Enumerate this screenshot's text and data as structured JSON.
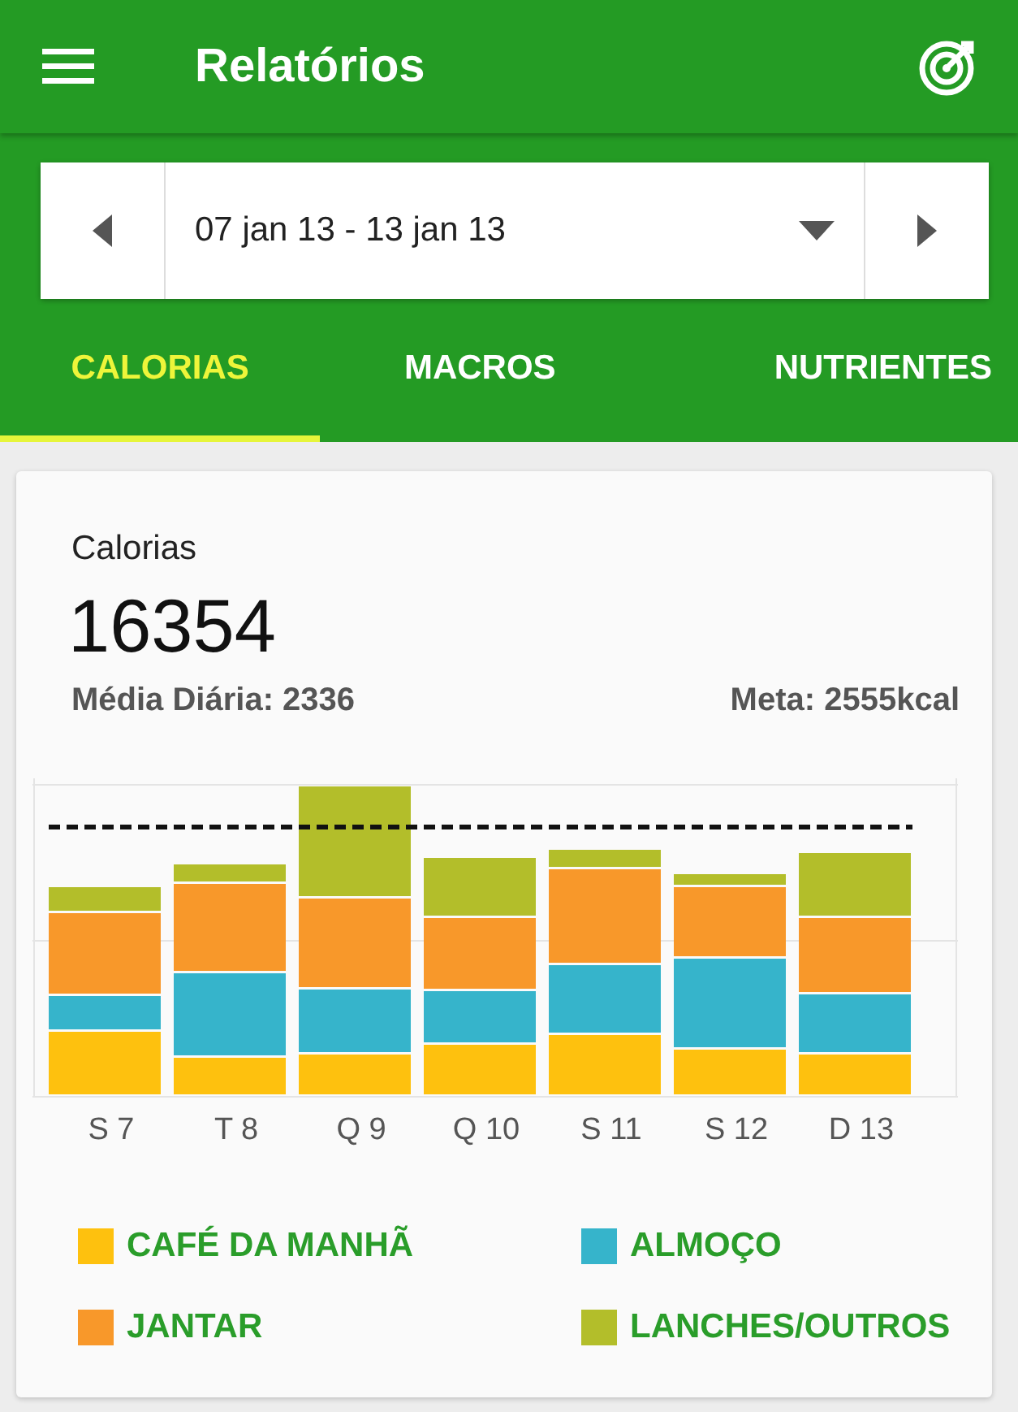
{
  "app_bar": {
    "title": "Relatórios"
  },
  "date_range": {
    "value": "07 jan 13 - 13 jan 13"
  },
  "tabs": [
    {
      "label": "CALORIAS",
      "selected": true
    },
    {
      "label": "MACROS",
      "selected": false
    },
    {
      "label": "NUTRIENTES",
      "selected": false
    }
  ],
  "summary": {
    "label": "Calorias",
    "total": "16354",
    "daily_average": "Média Diária: 2336",
    "goal": "Meta: 2555kcal"
  },
  "chart_days": [
    "S 7",
    "T 8",
    "Q 9",
    "Q 10",
    "S 11",
    "S 12",
    "D 13"
  ],
  "legend": [
    {
      "label": "CAFÉ DA MANHÃ",
      "color": "#fec10e"
    },
    {
      "label": "ALMOÇO",
      "color": "#36b4cb"
    },
    {
      "label": "JANTAR",
      "color": "#f8982a"
    },
    {
      "label": "LANCHES/OUTROS",
      "color": "#b3be2a"
    }
  ]
}
